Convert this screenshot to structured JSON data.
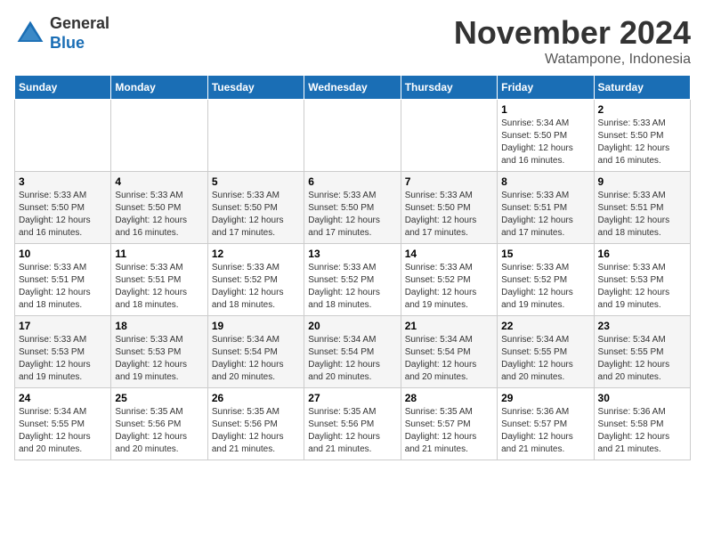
{
  "logo": {
    "general": "General",
    "blue": "Blue"
  },
  "header": {
    "month": "November 2024",
    "location": "Watampone, Indonesia"
  },
  "weekdays": [
    "Sunday",
    "Monday",
    "Tuesday",
    "Wednesday",
    "Thursday",
    "Friday",
    "Saturday"
  ],
  "weeks": [
    [
      {
        "day": "",
        "info": ""
      },
      {
        "day": "",
        "info": ""
      },
      {
        "day": "",
        "info": ""
      },
      {
        "day": "",
        "info": ""
      },
      {
        "day": "",
        "info": ""
      },
      {
        "day": "1",
        "info": "Sunrise: 5:34 AM\nSunset: 5:50 PM\nDaylight: 12 hours and 16 minutes."
      },
      {
        "day": "2",
        "info": "Sunrise: 5:33 AM\nSunset: 5:50 PM\nDaylight: 12 hours and 16 minutes."
      }
    ],
    [
      {
        "day": "3",
        "info": "Sunrise: 5:33 AM\nSunset: 5:50 PM\nDaylight: 12 hours and 16 minutes."
      },
      {
        "day": "4",
        "info": "Sunrise: 5:33 AM\nSunset: 5:50 PM\nDaylight: 12 hours and 16 minutes."
      },
      {
        "day": "5",
        "info": "Sunrise: 5:33 AM\nSunset: 5:50 PM\nDaylight: 12 hours and 17 minutes."
      },
      {
        "day": "6",
        "info": "Sunrise: 5:33 AM\nSunset: 5:50 PM\nDaylight: 12 hours and 17 minutes."
      },
      {
        "day": "7",
        "info": "Sunrise: 5:33 AM\nSunset: 5:50 PM\nDaylight: 12 hours and 17 minutes."
      },
      {
        "day": "8",
        "info": "Sunrise: 5:33 AM\nSunset: 5:51 PM\nDaylight: 12 hours and 17 minutes."
      },
      {
        "day": "9",
        "info": "Sunrise: 5:33 AM\nSunset: 5:51 PM\nDaylight: 12 hours and 18 minutes."
      }
    ],
    [
      {
        "day": "10",
        "info": "Sunrise: 5:33 AM\nSunset: 5:51 PM\nDaylight: 12 hours and 18 minutes."
      },
      {
        "day": "11",
        "info": "Sunrise: 5:33 AM\nSunset: 5:51 PM\nDaylight: 12 hours and 18 minutes."
      },
      {
        "day": "12",
        "info": "Sunrise: 5:33 AM\nSunset: 5:52 PM\nDaylight: 12 hours and 18 minutes."
      },
      {
        "day": "13",
        "info": "Sunrise: 5:33 AM\nSunset: 5:52 PM\nDaylight: 12 hours and 18 minutes."
      },
      {
        "day": "14",
        "info": "Sunrise: 5:33 AM\nSunset: 5:52 PM\nDaylight: 12 hours and 19 minutes."
      },
      {
        "day": "15",
        "info": "Sunrise: 5:33 AM\nSunset: 5:52 PM\nDaylight: 12 hours and 19 minutes."
      },
      {
        "day": "16",
        "info": "Sunrise: 5:33 AM\nSunset: 5:53 PM\nDaylight: 12 hours and 19 minutes."
      }
    ],
    [
      {
        "day": "17",
        "info": "Sunrise: 5:33 AM\nSunset: 5:53 PM\nDaylight: 12 hours and 19 minutes."
      },
      {
        "day": "18",
        "info": "Sunrise: 5:33 AM\nSunset: 5:53 PM\nDaylight: 12 hours and 19 minutes."
      },
      {
        "day": "19",
        "info": "Sunrise: 5:34 AM\nSunset: 5:54 PM\nDaylight: 12 hours and 20 minutes."
      },
      {
        "day": "20",
        "info": "Sunrise: 5:34 AM\nSunset: 5:54 PM\nDaylight: 12 hours and 20 minutes."
      },
      {
        "day": "21",
        "info": "Sunrise: 5:34 AM\nSunset: 5:54 PM\nDaylight: 12 hours and 20 minutes."
      },
      {
        "day": "22",
        "info": "Sunrise: 5:34 AM\nSunset: 5:55 PM\nDaylight: 12 hours and 20 minutes."
      },
      {
        "day": "23",
        "info": "Sunrise: 5:34 AM\nSunset: 5:55 PM\nDaylight: 12 hours and 20 minutes."
      }
    ],
    [
      {
        "day": "24",
        "info": "Sunrise: 5:34 AM\nSunset: 5:55 PM\nDaylight: 12 hours and 20 minutes."
      },
      {
        "day": "25",
        "info": "Sunrise: 5:35 AM\nSunset: 5:56 PM\nDaylight: 12 hours and 20 minutes."
      },
      {
        "day": "26",
        "info": "Sunrise: 5:35 AM\nSunset: 5:56 PM\nDaylight: 12 hours and 21 minutes."
      },
      {
        "day": "27",
        "info": "Sunrise: 5:35 AM\nSunset: 5:56 PM\nDaylight: 12 hours and 21 minutes."
      },
      {
        "day": "28",
        "info": "Sunrise: 5:35 AM\nSunset: 5:57 PM\nDaylight: 12 hours and 21 minutes."
      },
      {
        "day": "29",
        "info": "Sunrise: 5:36 AM\nSunset: 5:57 PM\nDaylight: 12 hours and 21 minutes."
      },
      {
        "day": "30",
        "info": "Sunrise: 5:36 AM\nSunset: 5:58 PM\nDaylight: 12 hours and 21 minutes."
      }
    ]
  ]
}
